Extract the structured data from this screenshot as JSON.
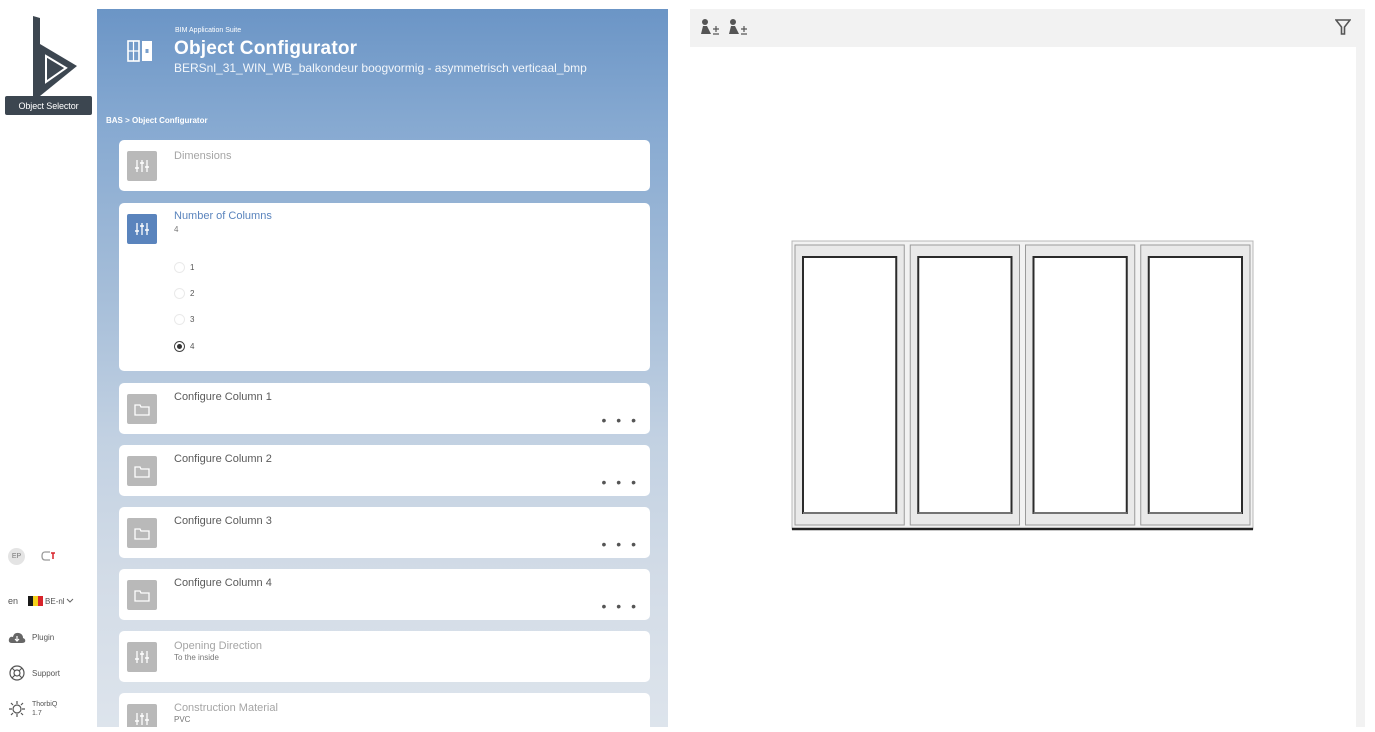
{
  "rail": {
    "selector_label": "Object Selector",
    "ep_label": "EP",
    "language": "en",
    "region": "BE-nl",
    "plugin_label": "Plugin",
    "support_label": "Support",
    "thorbiq_label": "ThorbiQ",
    "thorbiq_version": "1.7",
    "flag_colors": [
      "#1a1a1a",
      "#f4d21c",
      "#d8232a"
    ]
  },
  "header": {
    "suite": "BIM Application Suite",
    "title": "Object Configurator",
    "object_name": "BERSnl_31_WIN_WB_balkondeur boogvormig - asymmetrisch verticaal_bmp"
  },
  "breadcrumb": "BAS > Object Configurator",
  "cards": {
    "dimensions": {
      "title": "Dimensions"
    },
    "columns": {
      "title": "Number of Columns",
      "value": "4",
      "options": [
        "1",
        "2",
        "3",
        "4"
      ],
      "selected": "4"
    },
    "col1": {
      "title": "Configure Column 1",
      "more": "• • •"
    },
    "col2": {
      "title": "Configure Column 2",
      "more": "• • •"
    },
    "col3": {
      "title": "Configure Column 3",
      "more": "• • •"
    },
    "col4": {
      "title": "Configure Column 4",
      "more": "• • •"
    },
    "opening": {
      "title": "Opening Direction",
      "value": "To the inside"
    },
    "material": {
      "title": "Construction Material",
      "value": "PVC"
    }
  },
  "colors": {
    "accent": "#5a84bd",
    "icon_inactive": "#b9b9b9",
    "panel_top": "#6b95c6"
  },
  "viewer": {
    "preview_columns": 4
  }
}
